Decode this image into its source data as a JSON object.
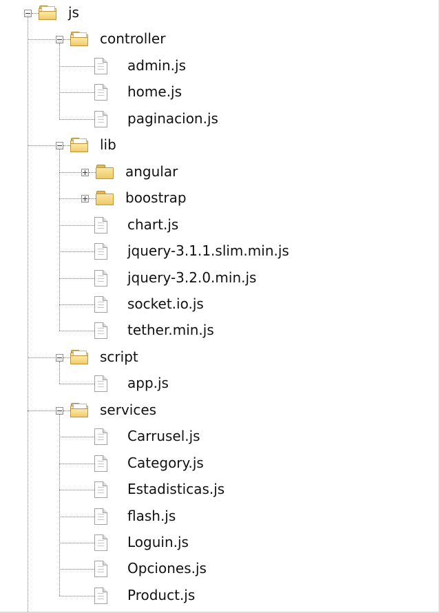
{
  "tree": {
    "root": {
      "label": "js",
      "state": "expanded"
    },
    "controller": {
      "label": "controller",
      "state": "expanded",
      "files": [
        "admin.js",
        "home.js",
        "paginacion.js"
      ]
    },
    "lib": {
      "label": "lib",
      "state": "expanded",
      "folders": [
        "angular",
        "boostrap"
      ],
      "folder_state": "collapsed",
      "files": [
        "chart.js",
        "jquery-3.1.1.slim.min.js",
        "jquery-3.2.0.min.js",
        "socket.io.js",
        "tether.min.js"
      ]
    },
    "script": {
      "label": "script",
      "state": "expanded",
      "files": [
        "app.js"
      ]
    },
    "services": {
      "label": "services",
      "state": "expanded",
      "files": [
        "Carrusel.js",
        "Category.js",
        "Estadisticas.js",
        "flash.js",
        "Loguin.js",
        "Opciones.js",
        "Product.js"
      ]
    }
  },
  "icons": {
    "folder_closed": "folder-icon",
    "folder_open": "folder-open-icon",
    "file": "file-icon",
    "expand": "plus-box-icon",
    "collapse": "minus-box-icon"
  },
  "colors": {
    "background": "#ffffff",
    "folder": "#efc967",
    "tree_lines": "#7a7a7a",
    "text": "#111111"
  }
}
